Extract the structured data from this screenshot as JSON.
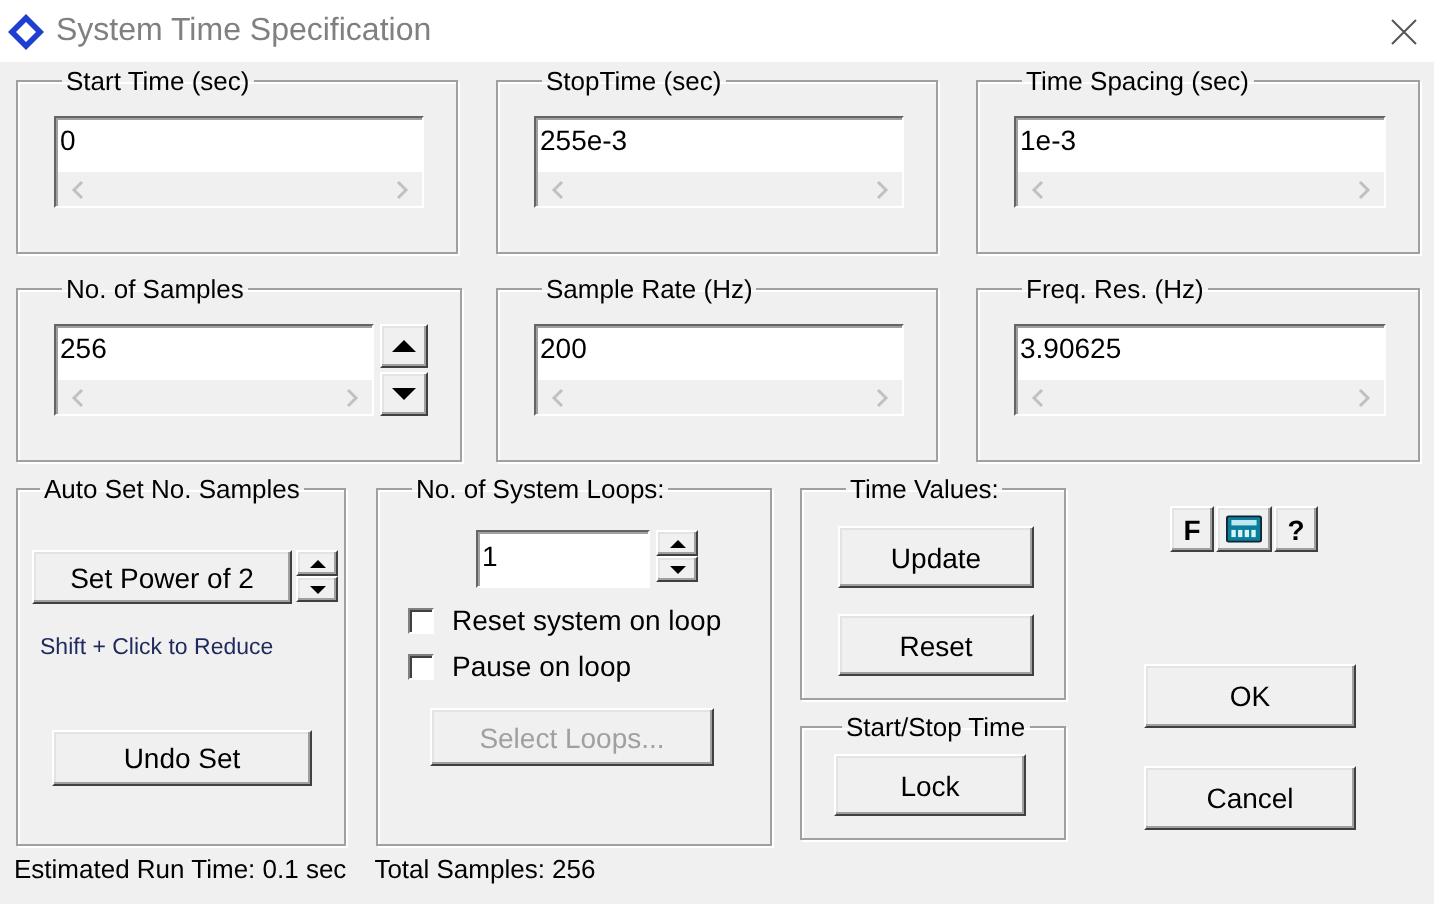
{
  "window": {
    "title": "System Time Specification"
  },
  "time_fields": [
    {
      "kind": "text",
      "label": "Start Time (sec)",
      "value": "0"
    },
    {
      "kind": "text",
      "label": "StopTime (sec)",
      "value": "255e-3"
    },
    {
      "kind": "text",
      "label": "Time Spacing (sec)",
      "value": "1e-3"
    },
    {
      "kind": "spin",
      "label": "No. of Samples",
      "value": "256"
    },
    {
      "kind": "text",
      "label": "Sample Rate (Hz)",
      "value": "200"
    },
    {
      "kind": "text",
      "label": "Freq. Res. (Hz)",
      "value": "3.90625"
    }
  ],
  "auto_set": {
    "label": "Auto Set No. Samples",
    "button": "Set Power of 2",
    "hint": "Shift + Click to Reduce",
    "undo_button": "Undo Set"
  },
  "system_loops": {
    "label": "No. of System Loops:",
    "value": "1",
    "options": [
      {
        "label": "Reset system on loop",
        "checked": false
      },
      {
        "label": "Pause on loop",
        "checked": false
      }
    ],
    "button": {
      "label": "Select Loops...",
      "disabled": true
    }
  },
  "time_values": {
    "label": "Time Values:",
    "buttons": [
      {
        "label": "Update"
      },
      {
        "label": "Reset"
      }
    ]
  },
  "start_stop": {
    "label": "Start/Stop Time",
    "button": "Lock"
  },
  "tool_buttons": [
    {
      "kind": "text",
      "label": "F"
    },
    {
      "kind": "calculator"
    },
    {
      "kind": "text",
      "label": "?"
    }
  ],
  "buttons": [
    "OK",
    "Cancel"
  ],
  "status_bar": [
    "Estimated Run Time: 0.1 sec",
    "Total Samples: 256"
  ]
}
